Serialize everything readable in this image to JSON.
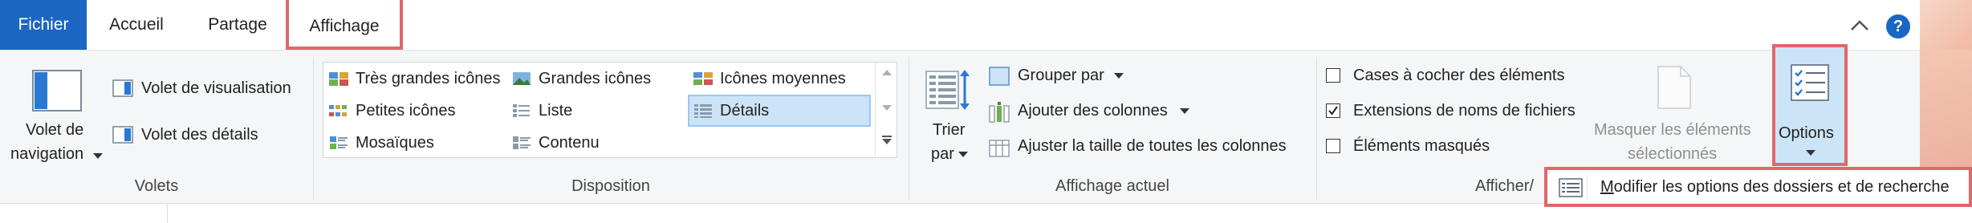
{
  "tabs": {
    "file": "Fichier",
    "home": "Accueil",
    "share": "Partage",
    "view": "Affichage"
  },
  "help_glyph": "?",
  "panes": {
    "nav_pane_line1": "Volet de",
    "nav_pane_line2": "navigation",
    "preview_pane": "Volet de visualisation",
    "details_pane": "Volet des détails",
    "group_label": "Volets"
  },
  "layout": {
    "items": [
      "Très grandes icônes",
      "Grandes icônes",
      "Icônes moyennes",
      "Petites icônes",
      "Liste",
      "Détails",
      "Mosaïques",
      "Contenu"
    ],
    "selected": "Détails",
    "group_label": "Disposition"
  },
  "current_view": {
    "sort_by_line1": "Trier",
    "sort_by_line2": "par",
    "group_by": "Grouper par",
    "add_columns": "Ajouter des colonnes",
    "size_all_columns": "Ajuster la taille de toutes les colonnes",
    "group_label": "Affichage actuel"
  },
  "show_hide": {
    "item_checkboxes": "Cases à cocher des éléments",
    "item_checkboxes_checked": false,
    "file_name_extensions": "Extensions de noms de fichiers",
    "file_name_extensions_checked": true,
    "hidden_items": "Éléments masqués",
    "hidden_items_checked": false,
    "hide_selected_line1": "Masquer les éléments",
    "hide_selected_line2": "sélectionnés",
    "group_label": "Afficher/"
  },
  "options": {
    "label": "Options",
    "menu_item_accel": "M",
    "menu_item_rest": "odifier les options des dossiers et de recherche"
  },
  "colors": {
    "accent": "#1a66c2",
    "highlight_border": "#e0676a",
    "selected_bg": "#cce4f7"
  }
}
